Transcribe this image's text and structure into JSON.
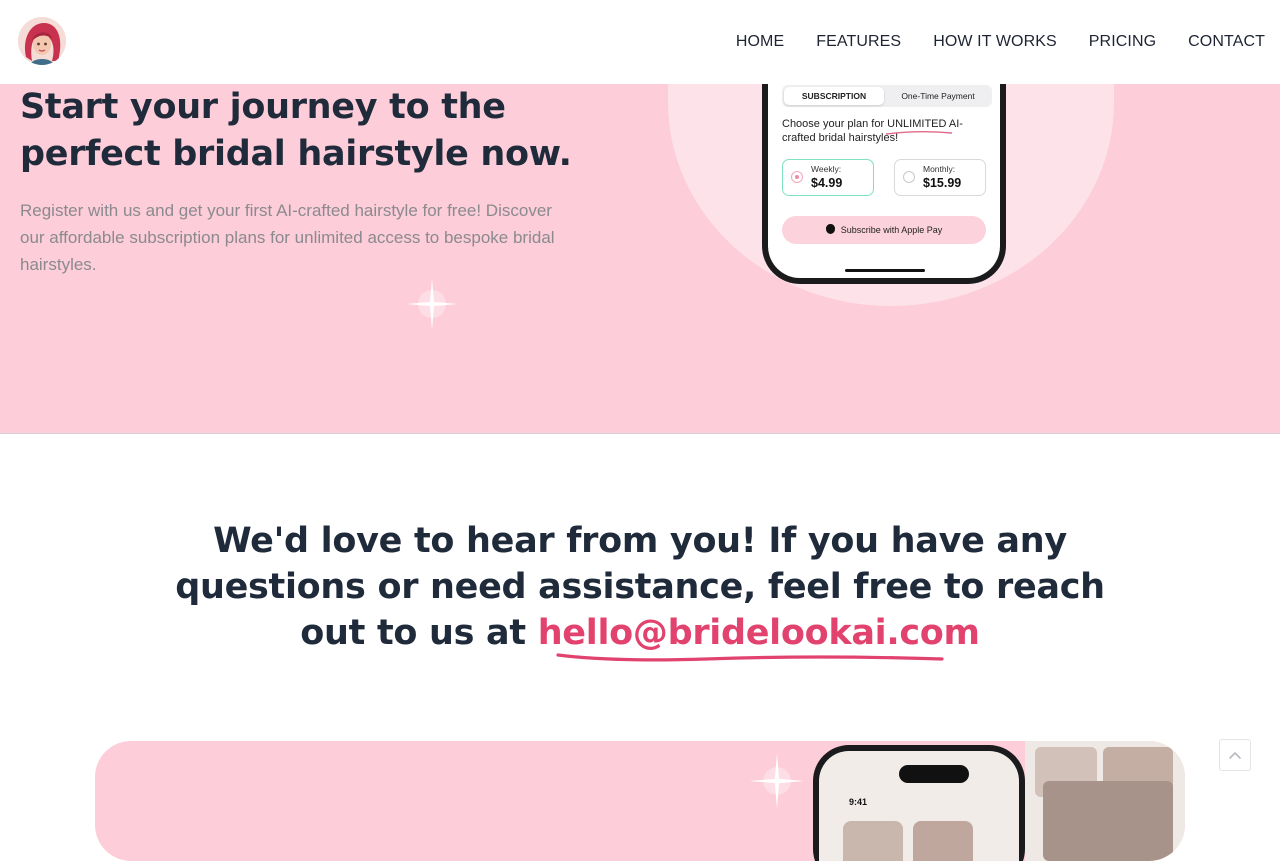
{
  "nav": {
    "items": [
      "HOME",
      "FEATURES",
      "HOW IT WORKS",
      "PRICING",
      "CONTACT"
    ]
  },
  "hero": {
    "title": "Start your journey to the perfect bridal hairstyle now.",
    "description": "Register with us and get your first AI-crafted hairstyle for free! Discover our affordable subscription plans for unlimited access to bespoke bridal hairstyles."
  },
  "phone": {
    "tab_subscription": "SUBSCRIPTION",
    "tab_one_time": "One-Time Payment",
    "plan_text": "Choose your plan for UNLIMITED AI-crafted bridal hairstyles!",
    "weekly_label": "Weekly:",
    "weekly_price": "$4.99",
    "monthly_label": "Monthly:",
    "monthly_price": "$15.99",
    "subscribe_label": "Subscribe with Apple Pay",
    "selected_plan": "Weekly"
  },
  "contact": {
    "text": "We'd love to hear from you! If you have any questions or need assistance, feel free to reach out to us at ",
    "email": "hello@bridelookai.com"
  },
  "bottom": {
    "phone_time": "9:41"
  },
  "colors": {
    "hero_bg": "#fdcdd9",
    "accent": "#e2436e",
    "heading": "#1f2a3a"
  },
  "icons": [
    "avatar-logo-icon",
    "sparkle-icon",
    "apple-icon",
    "chevron-up-icon"
  ]
}
